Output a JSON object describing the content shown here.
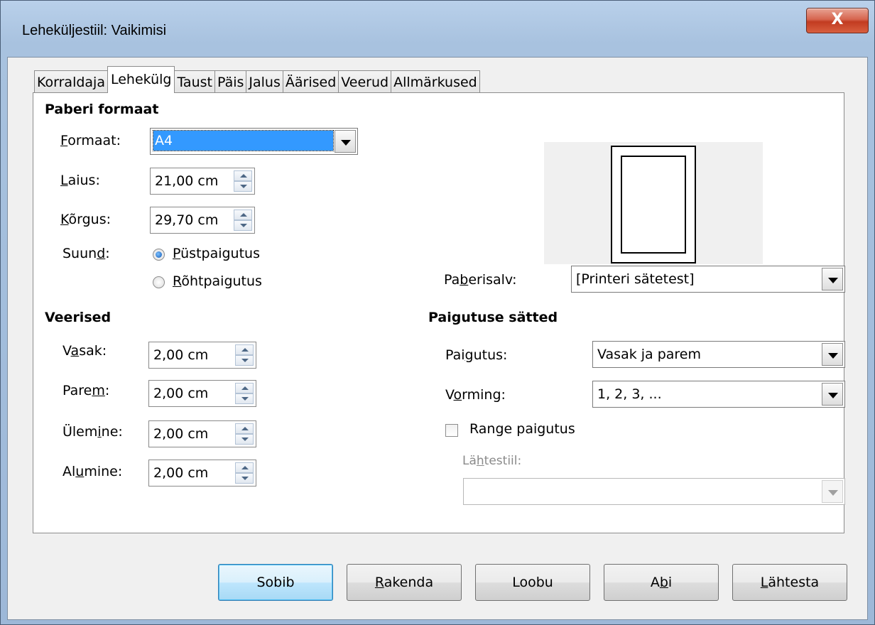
{
  "window": {
    "title": "Leheküljestiil: Vaikimisi",
    "close_label": "X"
  },
  "tabs": [
    {
      "label": "Korraldaja",
      "active": false
    },
    {
      "label": "Lehekülg",
      "active": true
    },
    {
      "label": "Taust",
      "active": false
    },
    {
      "label": "Päis",
      "active": false
    },
    {
      "label": "Jalus",
      "active": false
    },
    {
      "label": "Äärised",
      "active": false
    },
    {
      "label": "Veerud",
      "active": false
    },
    {
      "label": "Allmärkused",
      "active": false
    }
  ],
  "paper_format": {
    "section_title": "Paberi formaat",
    "format": {
      "label_u": "F",
      "label_rest": "ormaat:",
      "value": "A4"
    },
    "width": {
      "label_u": "L",
      "label_rest": "aius:",
      "value": "21,00 cm"
    },
    "height": {
      "label_pre": "",
      "label_u": "K",
      "label_rest": "õrgus:",
      "value": "29,70 cm"
    },
    "orientation": {
      "label_pre": "Suun",
      "label_u": "d",
      "label_rest": ":",
      "portrait": {
        "label_u": "P",
        "label_rest": "üstpaigutus",
        "checked": true
      },
      "landscape": {
        "label_u": "R",
        "label_rest": "õhtpaigutus",
        "checked": false
      }
    }
  },
  "paper_tray": {
    "label_pre": "Pa",
    "label_u": "b",
    "label_rest": "erisalv:",
    "value": "[Printeri sätetest]"
  },
  "margins": {
    "section_title": "Veerised",
    "left": {
      "label_pre": "V",
      "label_u": "a",
      "label_rest": "sak:",
      "value": "2,00 cm"
    },
    "right": {
      "label_pre": "Pare",
      "label_u": "m",
      "label_rest": ":",
      "value": "2,00 cm"
    },
    "top": {
      "label_pre": "Ülem",
      "label_u": "i",
      "label_rest": "ne:",
      "value": "2,00 cm"
    },
    "bottom": {
      "label_pre": "Al",
      "label_u": "u",
      "label_rest": "mine:",
      "value": "2,00 cm"
    }
  },
  "layout_settings": {
    "section_title": "Paigutuse sätted",
    "layout": {
      "label_pre": "Pai",
      "label_u": "g",
      "label_rest": "utus:",
      "value": "Vasak ja parem"
    },
    "format": {
      "label_pre": "V",
      "label_u": "o",
      "label_rest": "rming:",
      "value": "1, 2, 3, ..."
    },
    "register_true": {
      "label": "Range paigutus",
      "checked": false
    },
    "reference_style": {
      "label_pre": "Lä",
      "label_u": "h",
      "label_rest": "testiil:",
      "value": ""
    }
  },
  "buttons": {
    "ok": {
      "label": "Sobib"
    },
    "apply": {
      "label_u": "R",
      "label_rest": "akenda"
    },
    "cancel": {
      "label": "Loobu"
    },
    "help": {
      "label_pre": "A",
      "label_u": "b",
      "label_rest": "i"
    },
    "reset": {
      "label_u": "L",
      "label_rest": "ähtesta"
    }
  },
  "colors": {
    "selection": "#3399ff",
    "close_button": "#c23b21"
  }
}
